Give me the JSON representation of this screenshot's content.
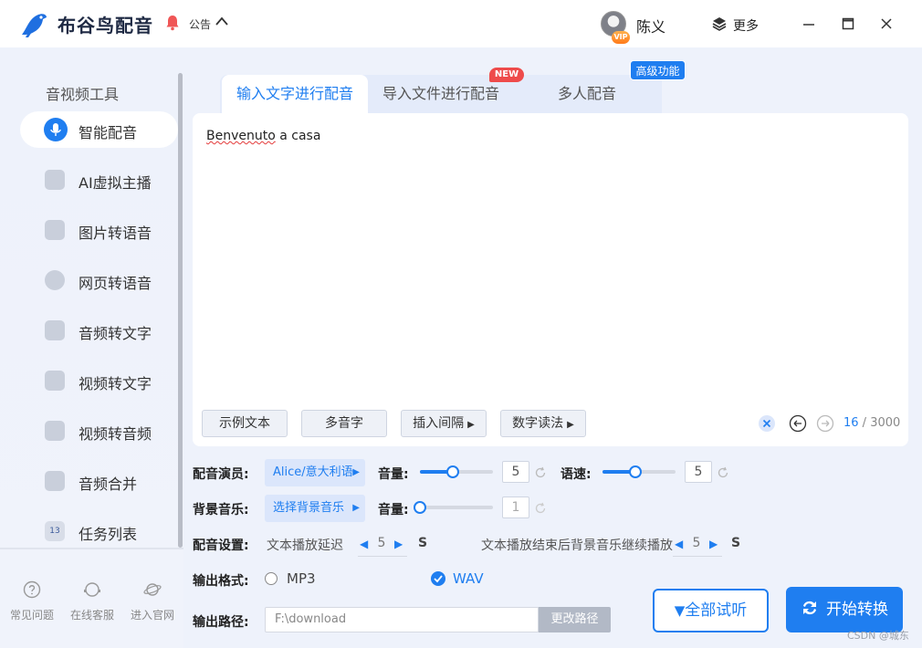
{
  "app": {
    "title": "布谷鸟配音",
    "notice_label": "公告"
  },
  "user": {
    "name": "陈义",
    "vip_label": "VIP"
  },
  "header": {
    "more_label": "更多"
  },
  "sidebar": {
    "heading": "音视频工具",
    "items": [
      {
        "label": "智能配音",
        "icon": "microphone-icon",
        "active": true
      },
      {
        "label": "AI虚拟主播",
        "icon": "avatar-presenter-icon"
      },
      {
        "label": "图片转语音",
        "icon": "image-icon"
      },
      {
        "label": "网页转语音",
        "icon": "globe-icon"
      },
      {
        "label": "音频转文字",
        "icon": "audio-text-icon"
      },
      {
        "label": "视频转文字",
        "icon": "video-text-icon"
      },
      {
        "label": "视频转音频",
        "icon": "video-audio-icon"
      },
      {
        "label": "音频合并",
        "icon": "merge-icon"
      },
      {
        "label": "任务列表",
        "icon": "task-list-icon",
        "badge": "13"
      }
    ],
    "footer": [
      {
        "label": "常见问题",
        "icon": "question-icon"
      },
      {
        "label": "在线客服",
        "icon": "support-icon"
      },
      {
        "label": "进入官网",
        "icon": "planet-icon"
      }
    ]
  },
  "tabs": [
    {
      "label": "输入文字进行配音",
      "active": true
    },
    {
      "label": "导入文件进行配音",
      "badge": "NEW"
    },
    {
      "label": "多人配音",
      "badge": "高级功能"
    }
  ],
  "editor": {
    "text_spell": "Benvenuto",
    "text_rest": " a casa",
    "buttons": {
      "sample": "示例文本",
      "polyphone": "多音字",
      "insert_pause": "插入间隔",
      "number_reading": "数字读法"
    },
    "char_count": "16",
    "char_max": " / 3000"
  },
  "settings": {
    "voice_label": "配音演员:",
    "voice_value": "Alice/意大利语",
    "volume_label": "音量:",
    "volume_value": "5",
    "volume_level": 0.45,
    "speed_label": "语速:",
    "speed_value": "5",
    "speed_level": 0.45,
    "bgm_label": "背景音乐:",
    "bgm_value": "选择背景音乐",
    "bgm_volume_label": "音量:",
    "bgm_volume_value": "1",
    "bgm_volume_level": 0.0,
    "config_label": "配音设置:",
    "delay_label": "文本播放延迟",
    "delay_value": "5",
    "delay_unit": "S",
    "continue_label": "文本播放结束后背景音乐继续播放",
    "continue_value": "5",
    "continue_unit": "S",
    "format_label": "输出格式:",
    "format_mp3": "MP3",
    "format_wav": "WAV",
    "format_selected": "WAV",
    "path_label": "输出路径:",
    "path_value": "F:\\download",
    "path_button": "更改路径"
  },
  "actions": {
    "preview": "全部试听",
    "start": "开始转换"
  },
  "watermark": "CSDN @城东",
  "colors": {
    "accent": "#1f7ef0",
    "new_badge": "#ee4b4b",
    "sidebar_bg": "#eef2fb"
  }
}
